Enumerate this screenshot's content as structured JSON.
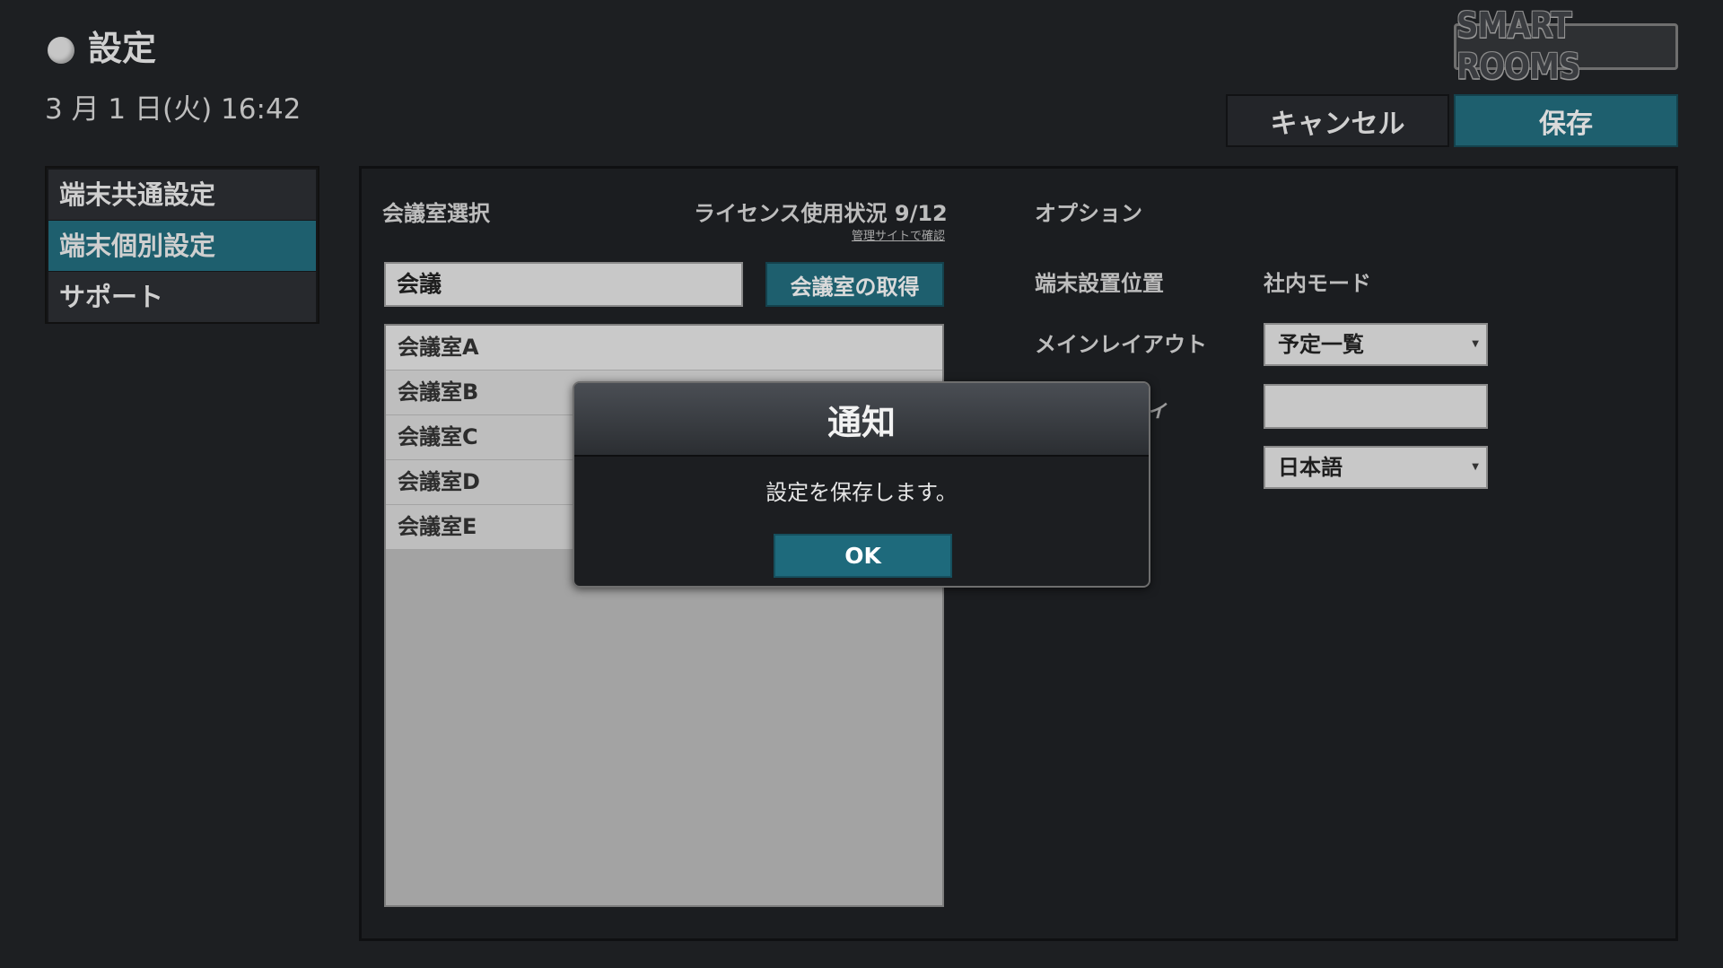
{
  "header": {
    "title": "設定",
    "datetime": "3 月 1 日(火) 16:42",
    "logo_text": "SMART ROOMS",
    "cancel_label": "キャンセル",
    "save_label": "保存"
  },
  "sidebar": {
    "items": [
      {
        "label": "端末共通設定",
        "active": false
      },
      {
        "label": "端末個別設定",
        "active": true
      },
      {
        "label": "サポート",
        "active": false
      }
    ]
  },
  "rooms": {
    "section_title": "会議室選択",
    "license_status": "ライセンス使用状況 9/12",
    "admin_link": "管理サイトで確認",
    "search_value": "会議",
    "fetch_label": "会議室の取得",
    "items": [
      "会議室A",
      "会議室B",
      "会議室C",
      "会議室D",
      "会議室E"
    ]
  },
  "options": {
    "section_title": "オプション",
    "location_label": "端末設置位置",
    "location_value": "社内モード",
    "layout_label": "メインレイアウト",
    "layout_value": "予定一覧",
    "obscured_label_fragment": "ィ",
    "language_value": "日本語"
  },
  "modal": {
    "title": "通知",
    "message": "設定を保存します。",
    "ok_label": "OK"
  },
  "colors": {
    "accent": "#1e5f6e",
    "background": "#1d1f22"
  }
}
